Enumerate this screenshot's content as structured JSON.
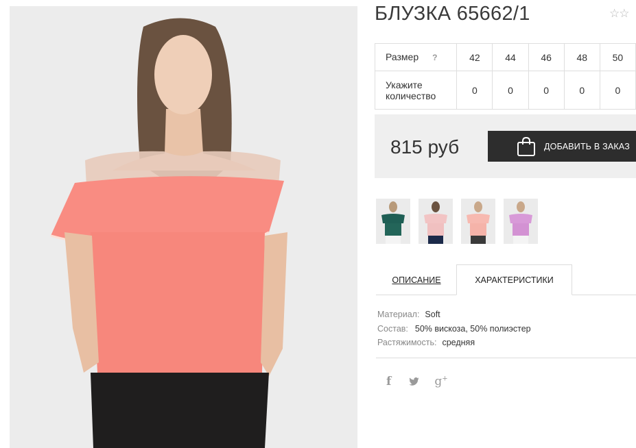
{
  "product": {
    "title": "БЛУЗКА 65662/1",
    "favorite_stars": "☆☆"
  },
  "size_table": {
    "size_label": "Размер",
    "help_icon": "?",
    "sizes": [
      "42",
      "44",
      "46",
      "48",
      "50"
    ],
    "quantity_label": "Укажите количество",
    "quantities": [
      "0",
      "0",
      "0",
      "0",
      "0"
    ]
  },
  "order": {
    "price": "815 руб",
    "add_button_label": "ДОБАВИТЬ В ЗАКАЗ",
    "button_icon": "shopping-bag-icon"
  },
  "thumbnails": [
    {
      "name": "thumb-green",
      "color": "#1f5f55"
    },
    {
      "name": "thumb-navy-pink",
      "color": "#f2c4c4"
    },
    {
      "name": "thumb-peach",
      "color": "#f7b9b0"
    },
    {
      "name": "thumb-lilac",
      "color": "#d89ad8"
    }
  ],
  "tabs": {
    "description": "ОПИСАНИЕ",
    "characteristics": "ХАРАКТЕРИСТИКИ"
  },
  "characteristics": [
    {
      "key": "Материал:",
      "value": "Soft"
    },
    {
      "key": "Состав:",
      "value": "50% вискоза, 50% полиэстер"
    },
    {
      "key": "Растяжимость:",
      "value": "средняя"
    }
  ],
  "social": {
    "facebook": "f",
    "twitter": "🐦",
    "google_plus": "g+"
  },
  "colors": {
    "blouse": "#f98c82",
    "button_bg": "#2d2d2d",
    "price_box_bg": "#efefef"
  }
}
